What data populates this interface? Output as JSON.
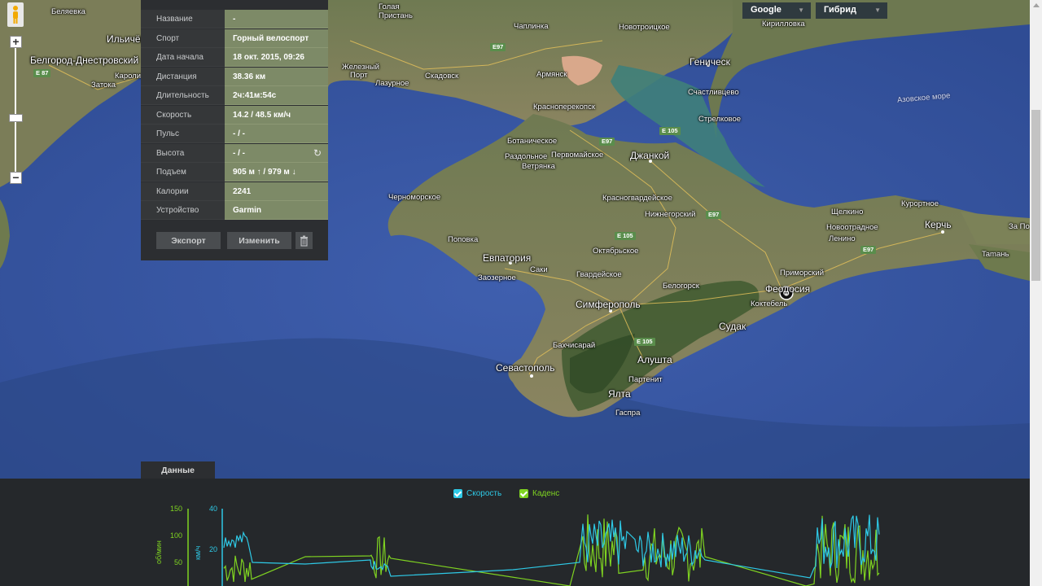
{
  "map": {
    "labels": {
      "belyaevka": "Беляевка",
      "ilichevsk": "Ильичёвск",
      "belgorod": "Белгород-Днестровский",
      "karolino": "Каролино",
      "zatoka": "Затока",
      "golaya": "Голая",
      "pristan": "Пристань",
      "chaplinka": "Чаплинка",
      "novotroitskoe": "Новотроицкое",
      "kirillovka": "Кирилловка",
      "zheleznyy": "Железный",
      "port": "Порт",
      "lazurnoe": "Лазурное",
      "skadovsk": "Скадовск",
      "armyansk": "Армянск",
      "genichesk": "Геническ",
      "schastlivtsevo": "Счастливцево",
      "azovskoe": "Азовское море",
      "krasnoperekopsk": "Красноперекопск",
      "strelkovoe": "Стрелковое",
      "botanicheskoe": "Ботаническое",
      "razdolnoe": "Раздольное",
      "pervomayskoe": "Первомайское",
      "dzhankoy": "Джанкой",
      "vetryanka": "Ветрянка",
      "chernomorskoe": "Черноморское",
      "krasnogvardeyskoe": "Красногвардейское",
      "shchelkino": "Щелкино",
      "kurortnoe": "Курортное",
      "nizhnegorskiy": "Нижнегорский",
      "novootradnoe": "Новоотрадное",
      "kerch": "Керчь",
      "lenino": "Ленино",
      "popovka": "Поповка",
      "oktyabrskoe": "Октябрьское",
      "evpatoriya": "Евпатория",
      "saki": "Саки",
      "primorskiy": "Приморский",
      "taman": "Tamань",
      "zaozernoe": "Заозерное",
      "gvardeyskoe": "Гвардейское",
      "belogorsk": "Белогорск",
      "feodosiya": "Феодосия",
      "simferopol": "Симферополь",
      "koktebel": "Коктебель",
      "sudak": "Судак",
      "bakhchisaray": "Бахчисарай",
      "alushta": "Алушта",
      "sevastopol": "Севастополь",
      "partenit": "Партенит",
      "yalta": "Ялта",
      "gaspra": "Гаспра",
      "zapo": "За По"
    },
    "roads": {
      "e87": "E 87",
      "e97a": "E97",
      "e97b": "E97",
      "e97c": "E97",
      "e97d": "E97",
      "e105a": "E 105",
      "e105b": "E 105",
      "e105c": "E 105"
    },
    "type_buttons": {
      "provider": "Google",
      "mode": "Гибрид"
    },
    "zoom": {
      "plus": "+",
      "minus_mid": "−",
      "minus": "−"
    }
  },
  "info": {
    "rows": [
      {
        "key": "Название",
        "value": "-"
      },
      {
        "key": "Спорт",
        "value": "Горный велоспорт"
      },
      {
        "key": "Дата начала",
        "value": "18 окт. 2015, 09:26"
      },
      {
        "key": "Дистанция",
        "value": "38.36 км"
      },
      {
        "key": "Длительность",
        "value": "2ч:41м:54с"
      },
      {
        "key": "Скорость",
        "value": "14.2 / 48.5 км/ч"
      },
      {
        "key": "Пульс",
        "value": "- / -"
      },
      {
        "key": "Высота",
        "value": "- / -"
      },
      {
        "key": "Подъем",
        "value": "905 м ↑ / 979 м ↓"
      },
      {
        "key": "Калории",
        "value": "2241"
      },
      {
        "key": "Устройство",
        "value": "Garmin"
      }
    ],
    "export_label": "Экспорт",
    "edit_label": "Изменить"
  },
  "data_panel": {
    "tab_label": "Данные",
    "legend": {
      "speed": "Скорость",
      "cadence": "Каденс"
    },
    "colors": {
      "speed": "#2ec9e6",
      "cadence": "#7fd321",
      "left_axis": "#7fd321",
      "right_axis": "#2ec9e6"
    }
  },
  "chart_data": {
    "type": "line",
    "series": [
      {
        "name": "Скорость",
        "axis": "km/h"
      },
      {
        "name": "Каденс",
        "axis": "rpm"
      }
    ],
    "left_axis": {
      "label": "об/мин",
      "ticks": [
        "150",
        "100",
        "50"
      ],
      "ylim": [
        0,
        150
      ]
    },
    "right_axis": {
      "label": "км/ч",
      "ticks": [
        "40",
        "20"
      ],
      "ylim": [
        0,
        40
      ]
    }
  }
}
